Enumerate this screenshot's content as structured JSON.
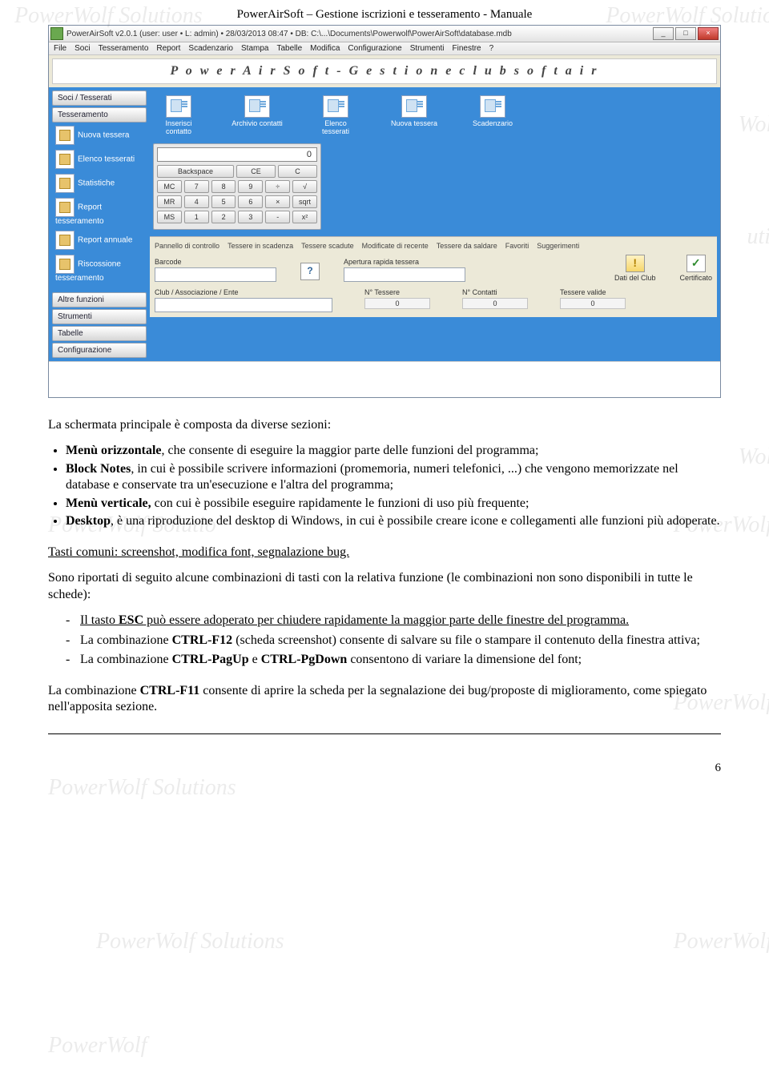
{
  "header": "PowerAirSoft – Gestione iscrizioni e tesseramento - Manuale",
  "page_number": "6",
  "watermarks": [
    "PowerWolf Solutions",
    "PowerWolf Solutio",
    "Wolf",
    "utio",
    "Wolf",
    "PowerWolf",
    "PowerWolf Solutio",
    "PowerWolf",
    "PowerWolf Solutions",
    "PowerWolf",
    "PowerWolf Solutions",
    "PowerWolf"
  ],
  "screenshot": {
    "title": "PowerAirSoft v2.0.1  (user: user  • L: admin) • 28/03/2013 08:47 • DB: C:\\...\\Documents\\Powerwolf\\PowerAirSoft\\database.mdb",
    "window_buttons": [
      "_",
      "□",
      "×"
    ],
    "menubar": [
      "File",
      "Soci",
      "Tesseramento",
      "Report",
      "Scadenzario",
      "Stampa",
      "Tabelle",
      "Modifica",
      "Configurazione",
      "Strumenti",
      "Finestre",
      "?"
    ],
    "banner": "P o w e r A i r S o f t   -   G e s t i o n e   c l u b   s o f t a i r",
    "sidebar": {
      "groups": [
        {
          "title": "Soci / Tesserati"
        },
        {
          "title": "Tesseramento",
          "items": [
            "Nuova tessera",
            "Elenco tesserati",
            "Statistiche",
            "Report tesseramento",
            "Report annuale",
            "Riscossione tesseramento"
          ]
        },
        {
          "title": "Altre funzioni"
        },
        {
          "title": "Strumenti"
        },
        {
          "title": "Tabelle"
        },
        {
          "title": "Configurazione"
        }
      ]
    },
    "toolbar": [
      "Inserisci contatto",
      "Archivio contatti",
      "Elenco tesserati",
      "Nuova tessera",
      "Scadenzario"
    ],
    "calc": {
      "display": "0",
      "rows": [
        [
          "Backspace",
          "CE",
          "C"
        ],
        [
          "MC",
          "7",
          "8",
          "9",
          "÷",
          "√"
        ],
        [
          "MR",
          "4",
          "5",
          "6",
          "×",
          "sqrt"
        ],
        [
          "MS",
          "1",
          "2",
          "3",
          "-",
          "x²"
        ]
      ]
    },
    "panel": {
      "tabs": [
        "Pannello di controllo",
        "Tessere in scadenza",
        "Tessere scadute",
        "Modificate di recente",
        "Tessere da saldare",
        "Favoriti",
        "Suggerimenti"
      ],
      "barcode_label": "Barcode",
      "apertura_label": "Apertura rapida tessera",
      "dati_label": "Dati del Club",
      "cert_label": "Certificato",
      "club_label": "Club / Associazione / Ente",
      "ntess_label": "N° Tessere",
      "ncont_label": "N° Contatti",
      "nvalid_label": "Tessere valide",
      "ntess": "0",
      "ncont": "0",
      "nvalid": "0"
    }
  },
  "doc": {
    "p1": "La schermata principale è composta da diverse sezioni:",
    "b1": [
      {
        "b": "Menù orizzontale",
        "t": ", che consente di eseguire la maggior parte delle funzioni del programma;"
      },
      {
        "b": "Block Notes",
        "t": ", in cui è possibile scrivere informazioni (promemoria, numeri telefonici, ...) che vengono memorizzate nel database e conservate tra un'esecuzione e l'altra del programma;"
      },
      {
        "b": "Menù verticale,",
        "t": " con cui è possibile eseguire rapidamente le funzioni di uso più frequente;"
      },
      {
        "b": "Desktop",
        "t": ", è una riproduzione del desktop di Windows, in cui è possibile creare icone e collegamenti alle funzioni più adoperate."
      }
    ],
    "sect": "Tasti comuni: screenshot, modifica font, segnalazione bug.",
    "p2": "Sono riportati di seguito alcune combinazioni di tasti con la relativa funzione (le combinazioni non sono disponibili in tutte le schede):",
    "dash": [
      "Il tasto <b>ESC</b> può essere adoperato per chiudere rapidamente la maggior parte delle finestre del programma.",
      "La combinazione <b>CTRL-F12</b> (scheda screenshot) consente di salvare su file o stampare il contenuto della finestra attiva;",
      "La combinazione <b>CTRL-PagUp</b> e <b>CTRL-PgDown</b> consentono di variare la dimensione del font;"
    ],
    "p3a": "La combinazione ",
    "p3b": "CTRL-F11",
    "p3c": " consente di aprire la scheda per la segnalazione dei bug/proposte di miglioramento, come spiegato nell'apposita sezione."
  }
}
